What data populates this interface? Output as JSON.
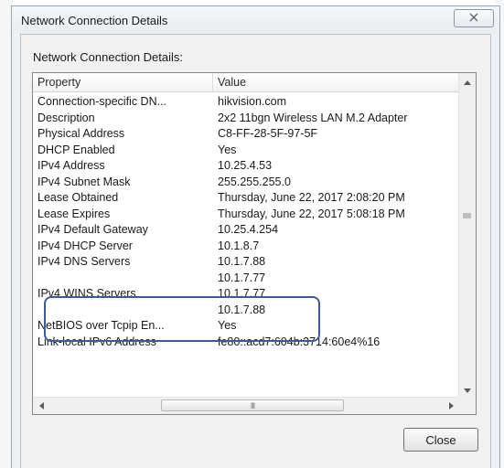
{
  "window": {
    "title": "Network Connection Details",
    "close_glyph": "✕"
  },
  "section_label": "Network Connection Details:",
  "table": {
    "columns": [
      "Property",
      "Value"
    ],
    "rows": [
      {
        "property": "Connection-specific DN...",
        "value": "hikvision.com"
      },
      {
        "property": "Description",
        "value": "2x2 11bgn Wireless LAN M.2 Adapter"
      },
      {
        "property": "Physical Address",
        "value": "C8-FF-28-5F-97-5F"
      },
      {
        "property": "DHCP Enabled",
        "value": "Yes"
      },
      {
        "property": "IPv4 Address",
        "value": "10.25.4.53"
      },
      {
        "property": "IPv4 Subnet Mask",
        "value": "255.255.255.0"
      },
      {
        "property": "Lease Obtained",
        "value": "Thursday, June 22, 2017 2:08:20 PM"
      },
      {
        "property": "Lease Expires",
        "value": "Thursday, June 22, 2017 5:08:18 PM"
      },
      {
        "property": "IPv4 Default Gateway",
        "value": "10.25.4.254"
      },
      {
        "property": "IPv4 DHCP Server",
        "value": "10.1.8.7"
      },
      {
        "property": "IPv4 DNS Servers",
        "value": "10.1.7.88"
      },
      {
        "property": "",
        "value": "10.1.7.77"
      },
      {
        "property": "IPv4 WINS Servers",
        "value": "10.1.7.77"
      },
      {
        "property": "",
        "value": "10.1.7.88"
      },
      {
        "property": "NetBIOS over Tcpip En...",
        "value": "Yes"
      },
      {
        "property": "Link-local IPv6 Address",
        "value": "fe80::acd7:604b:3714:60e4%16"
      }
    ]
  },
  "scrollbar": {
    "h_thumb_grip": "III"
  },
  "close_button_label": "Close",
  "colors": {
    "highlight_border": "#3d5a99"
  }
}
